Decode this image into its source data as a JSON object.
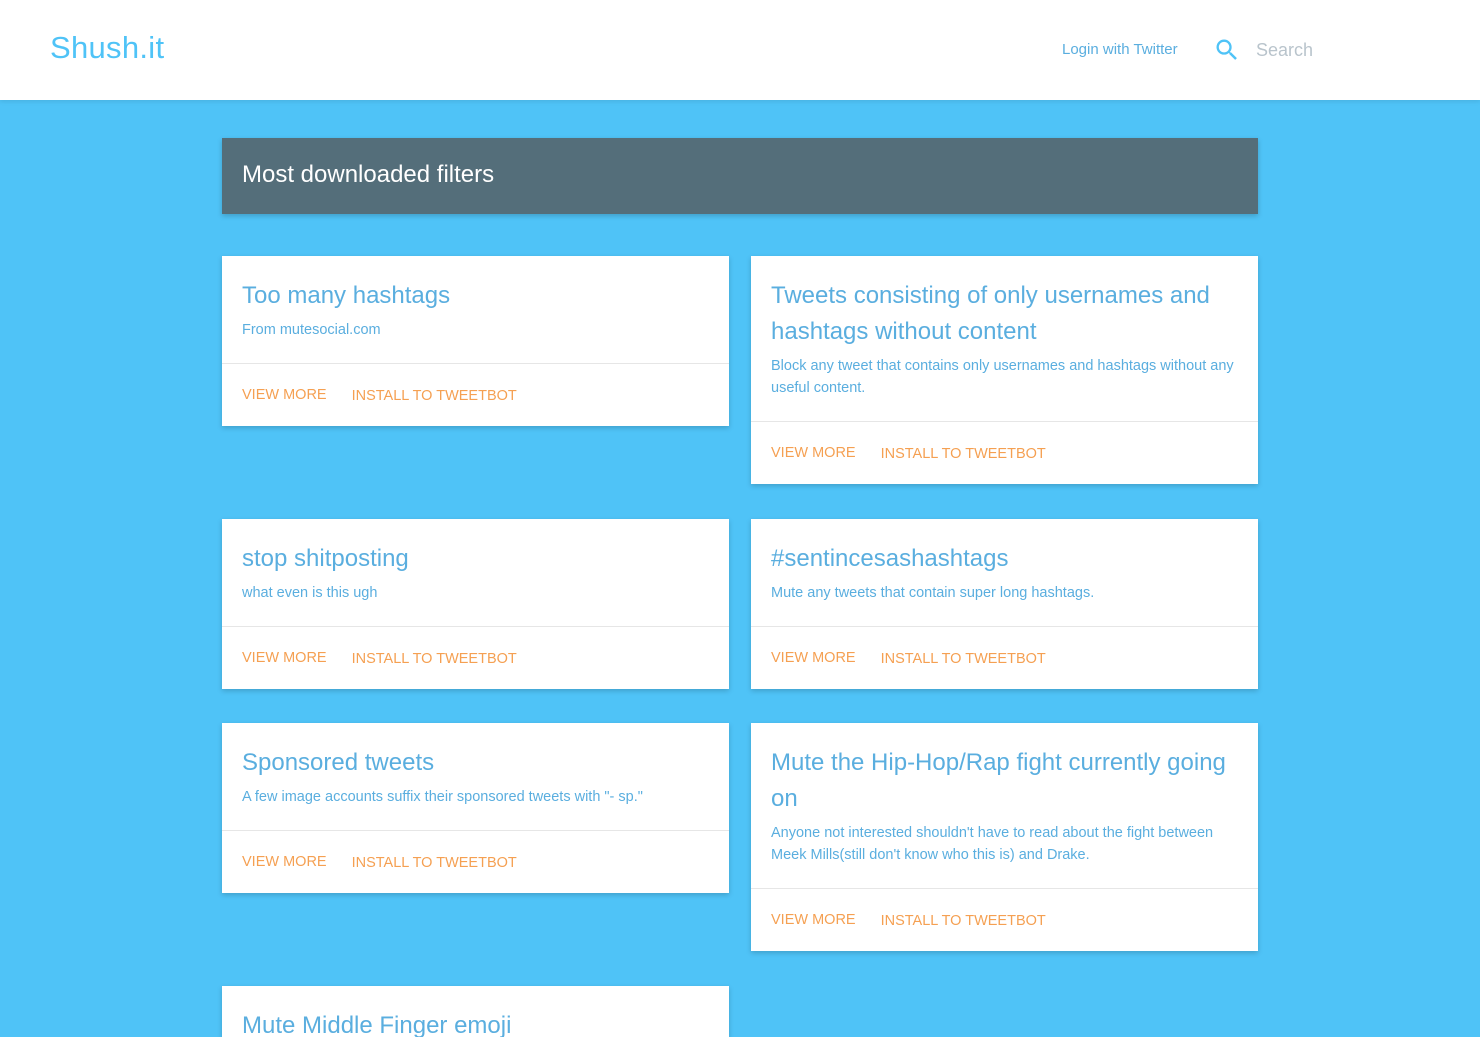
{
  "header": {
    "brand": "Shush.it",
    "login_label": "Login with Twitter",
    "search_icon": "search-icon",
    "search_placeholder": "Search",
    "search_value": ""
  },
  "section": {
    "title": "Most downloaded filters"
  },
  "colors": {
    "background": "#4fc3f7",
    "header_bar": "#546e7a",
    "accent_text": "#5aaedf",
    "action_text": "#f5a052"
  },
  "cards": [
    {
      "title": "Too many hashtags",
      "desc": "From mutesocial.com",
      "view_more": "VIEW MORE",
      "install": "INSTALL TO TWEETBOT"
    },
    {
      "title": "Tweets consisting of only usernames and hashtags without content",
      "desc": "Block any tweet that contains only usernames and hashtags without any useful content.",
      "view_more": "VIEW MORE",
      "install": "INSTALL TO TWEETBOT"
    },
    {
      "title": "stop shitposting",
      "desc": "what even is this ugh",
      "view_more": "VIEW MORE",
      "install": "INSTALL TO TWEETBOT"
    },
    {
      "title": "#sentincesashashtags",
      "desc": "Mute any tweets that contain super long hashtags.",
      "view_more": "VIEW MORE",
      "install": "INSTALL TO TWEETBOT"
    },
    {
      "title": "Sponsored tweets",
      "desc": "A few image accounts suffix their sponsored tweets with \"- sp.\"",
      "view_more": "VIEW MORE",
      "install": "INSTALL TO TWEETBOT"
    },
    {
      "title": "Mute the Hip-Hop/Rap fight currently going on",
      "desc": "Anyone not interested shouldn't have to read about the fight between Meek Mills(still don't know who this is) and Drake.",
      "view_more": "VIEW MORE",
      "install": "INSTALL TO TWEETBOT"
    },
    {
      "title": "Mute Middle Finger emoji"
    }
  ]
}
